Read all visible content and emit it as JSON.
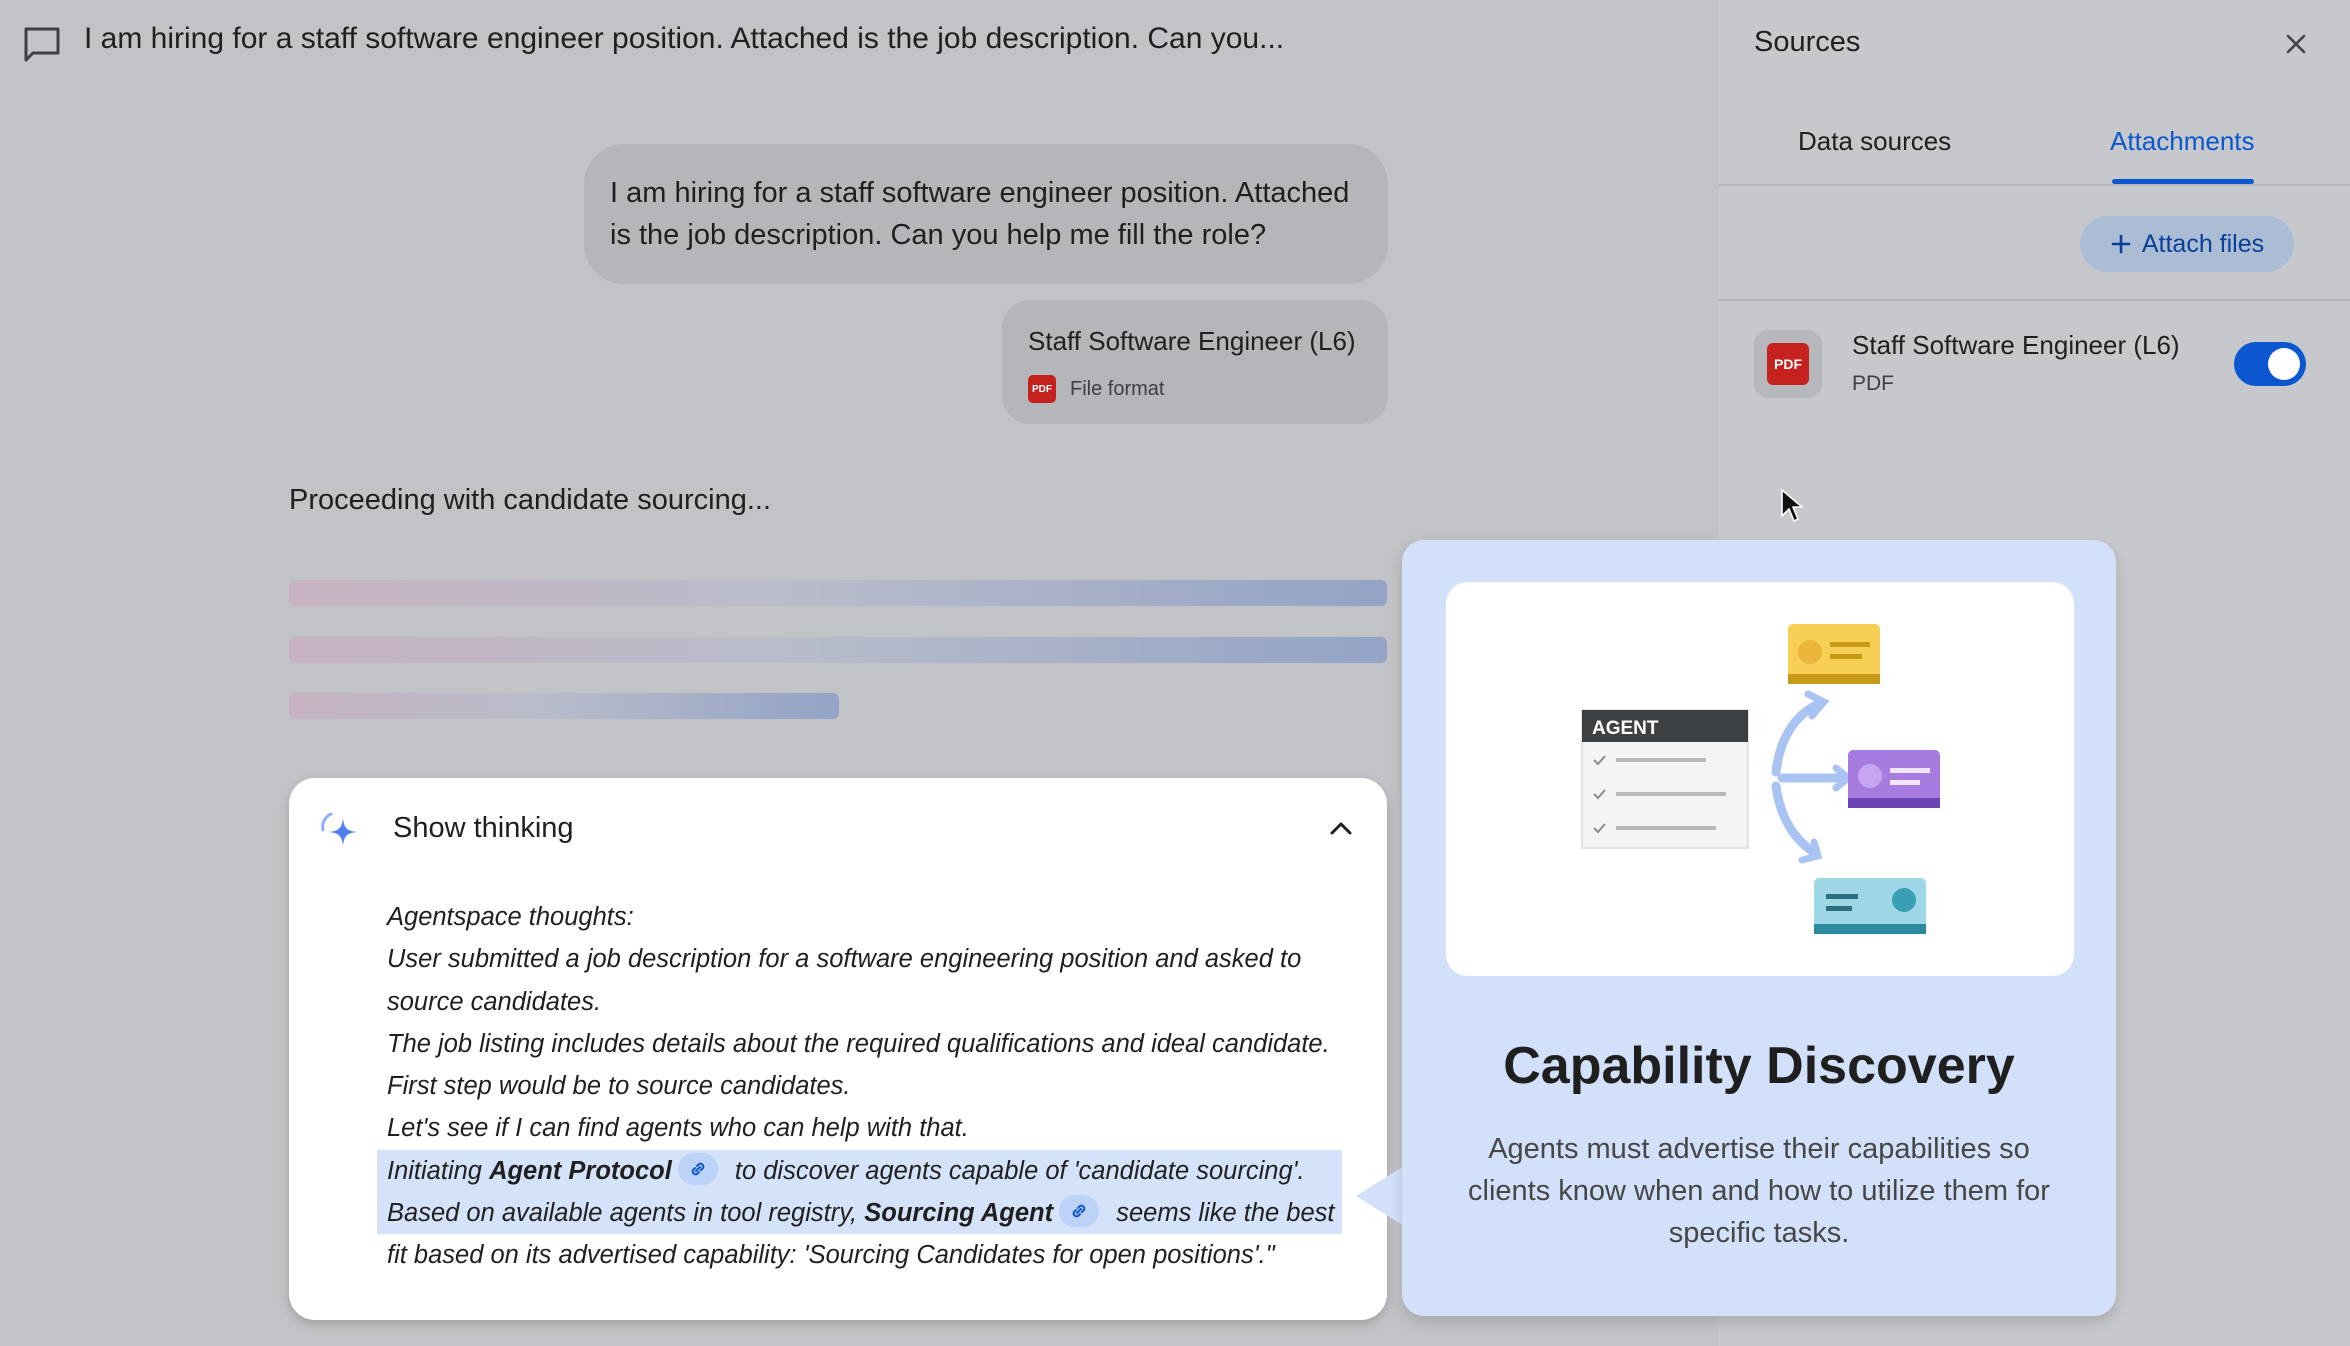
{
  "header": {
    "title": "I am hiring for a staff software engineer position. Attached is the job description. Can you..."
  },
  "conversation": {
    "user_message_line1": "I am hiring for a staff software engineer position. Attached",
    "user_message_line2": "is the job description. Can you help me fill the role?",
    "attachment": {
      "name": "Staff Software Engineer (L6)",
      "icon_label": "PDF",
      "format_label": "File format"
    },
    "status": "Proceeding with candidate sourcing..."
  },
  "thinking": {
    "toggle_label": "Show thinking",
    "lines": [
      "Agentspace thoughts:",
      "User submitted a job description for a software engineering position and asked to",
      "source candidates.",
      "The job listing includes details about the required qualifications and ideal candidate.",
      "First step would be to source candidates.",
      "Let's see if I can find agents who can help with that."
    ],
    "highlight1": {
      "before": "Initiating ",
      "bold": "Agent Protocol",
      "after": " to discover agents capable of 'candidate sourcing'."
    },
    "highlight2": {
      "before": "Based on available agents in tool registry, ",
      "bold": "Sourcing Agent",
      "after": " seems like the best"
    },
    "last_line": "fit based on its advertised capability: 'Sourcing Candidates for open positions'.\""
  },
  "sources_panel": {
    "title": "Sources",
    "tabs": [
      "Data sources",
      "Attachments"
    ],
    "active_tab": "Attachments",
    "attach_button": "Attach files",
    "file": {
      "name": "Staff Software Engineer (L6)",
      "type": "PDF",
      "icon_label": "PDF",
      "enabled": true
    }
  },
  "capability_card": {
    "agent_label": "AGENT",
    "title": "Capability Discovery",
    "description": "Agents must advertise their capabilities so clients know when and how to utilize them for specific tasks."
  },
  "colors": {
    "accent": "#0b57d0",
    "highlight": "#d4e3fa",
    "card_background": "#d3e0f9",
    "pdf_red": "#c5221f"
  },
  "icons": {
    "conversation": "chat-bubble-icon",
    "thinking": "sparkle-icon",
    "collapse": "chevron-up-icon",
    "close": "close-icon",
    "add": "plus-icon",
    "link": "link-icon"
  }
}
